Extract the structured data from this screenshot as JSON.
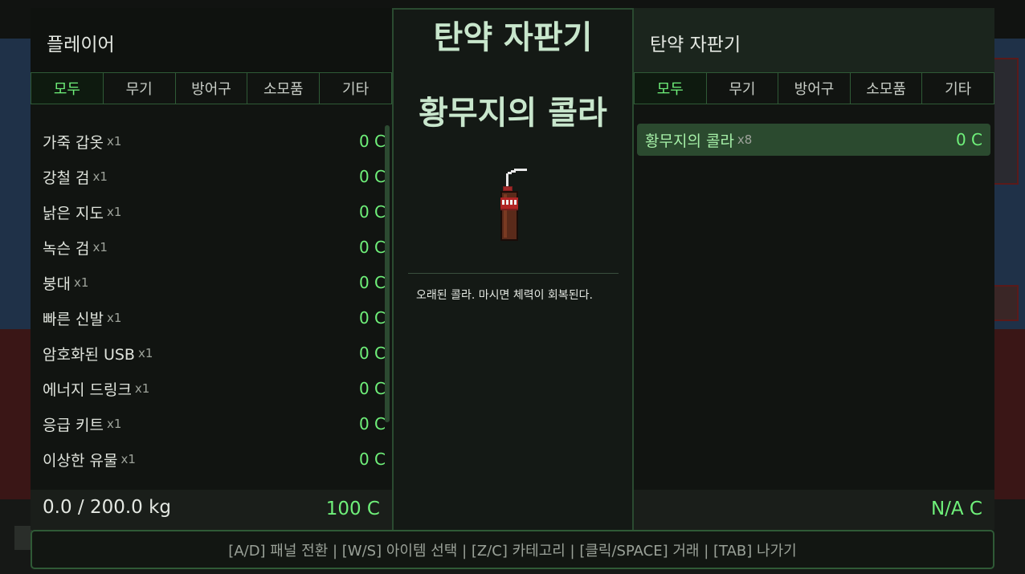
{
  "player_panel": {
    "title": "플레이어",
    "tabs": [
      {
        "label": "모두",
        "active": true
      },
      {
        "label": "무기",
        "active": false
      },
      {
        "label": "방어구",
        "active": false
      },
      {
        "label": "소모품",
        "active": false
      },
      {
        "label": "기타",
        "active": false
      }
    ],
    "items": [
      {
        "name": "가죽 갑옷",
        "qty": "x1",
        "price": "0 C"
      },
      {
        "name": "강철 검",
        "qty": "x1",
        "price": "0 C"
      },
      {
        "name": "낡은 지도",
        "qty": "x1",
        "price": "0 C"
      },
      {
        "name": "녹슨 검",
        "qty": "x1",
        "price": "0 C"
      },
      {
        "name": "붕대",
        "qty": "x1",
        "price": "0 C"
      },
      {
        "name": "빠른 신발",
        "qty": "x1",
        "price": "0 C"
      },
      {
        "name": "암호화된 USB",
        "qty": "x1",
        "price": "0 C"
      },
      {
        "name": "에너지 드링크",
        "qty": "x1",
        "price": "0 C"
      },
      {
        "name": "응급 키트",
        "qty": "x1",
        "price": "0 C"
      },
      {
        "name": "이상한 유물",
        "qty": "x1",
        "price": "0 C"
      }
    ],
    "weight": "0.0 / 200.0 kg",
    "money": "100 C"
  },
  "center_panel": {
    "title": "탄약 자판기",
    "selected_item_name": "황무지의 콜라",
    "item_icon": "cola-bottle-icon",
    "description": "오래된 콜라. 마시면 체력이 회복된다."
  },
  "vendor_panel": {
    "title": "탄약 자판기",
    "tabs": [
      {
        "label": "모두",
        "active": true
      },
      {
        "label": "무기",
        "active": false
      },
      {
        "label": "방어구",
        "active": false
      },
      {
        "label": "소모품",
        "active": false
      },
      {
        "label": "기타",
        "active": false
      }
    ],
    "items": [
      {
        "name": "황무지의 콜라",
        "qty": "x8",
        "price": "0 C",
        "selected": true
      }
    ],
    "money": "N/A C"
  },
  "hint_bar": {
    "text": "[A/D] 패널 전환 | [W/S] 아이템 선택 | [Z/C] 카테고리 | [클릭/SPACE] 거래 | [TAB] 나가기"
  },
  "colors": {
    "accent": "#6ff07a",
    "panel_border": "#2f5a36",
    "selected_row": "#2b4a2f"
  }
}
